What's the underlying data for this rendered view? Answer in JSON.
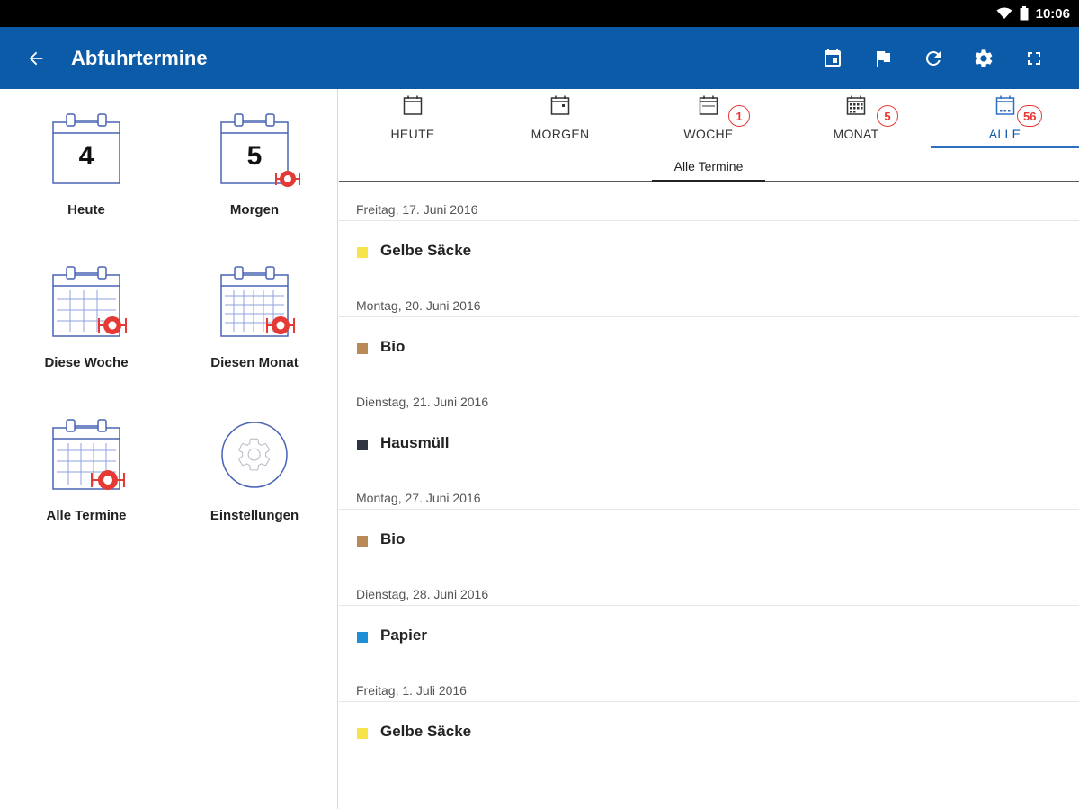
{
  "status": {
    "time": "10:06"
  },
  "appbar": {
    "title": "Abfuhrtermine"
  },
  "tiles": [
    {
      "label": "Heute",
      "number": "4"
    },
    {
      "label": "Morgen",
      "number": "5"
    },
    {
      "label": "Diese Woche"
    },
    {
      "label": "Diesen Monat"
    },
    {
      "label": "Alle Termine"
    },
    {
      "label": "Einstellungen"
    }
  ],
  "tabs": [
    {
      "label": "HEUTE",
      "badge": ""
    },
    {
      "label": "MORGEN",
      "badge": ""
    },
    {
      "label": "WOCHE",
      "badge": "1"
    },
    {
      "label": "MONAT",
      "badge": "5"
    },
    {
      "label": "ALLE",
      "badge": "56"
    }
  ],
  "subtab": {
    "label": "Alle Termine"
  },
  "groups": [
    {
      "date": "Freitag, 17. Juni 2016",
      "name": "Gelbe Säcke",
      "color": "#f7e44a"
    },
    {
      "date": "Montag, 20. Juni 2016",
      "name": "Bio",
      "color": "#b98a55"
    },
    {
      "date": "Dienstag, 21. Juni 2016",
      "name": "Hausmüll",
      "color": "#2e3440"
    },
    {
      "date": "Montag, 27. Juni 2016",
      "name": "Bio",
      "color": "#b98a55"
    },
    {
      "date": "Dienstag, 28. Juni 2016",
      "name": "Papier",
      "color": "#1e8fd6"
    },
    {
      "date": "Freitag, 1. Juli 2016",
      "name": "Gelbe Säcke",
      "color": "#f7e44a"
    }
  ],
  "colors": {
    "primary": "#0b5ba8",
    "badge": "#e53935",
    "calendar_line": "#4a63b5"
  }
}
